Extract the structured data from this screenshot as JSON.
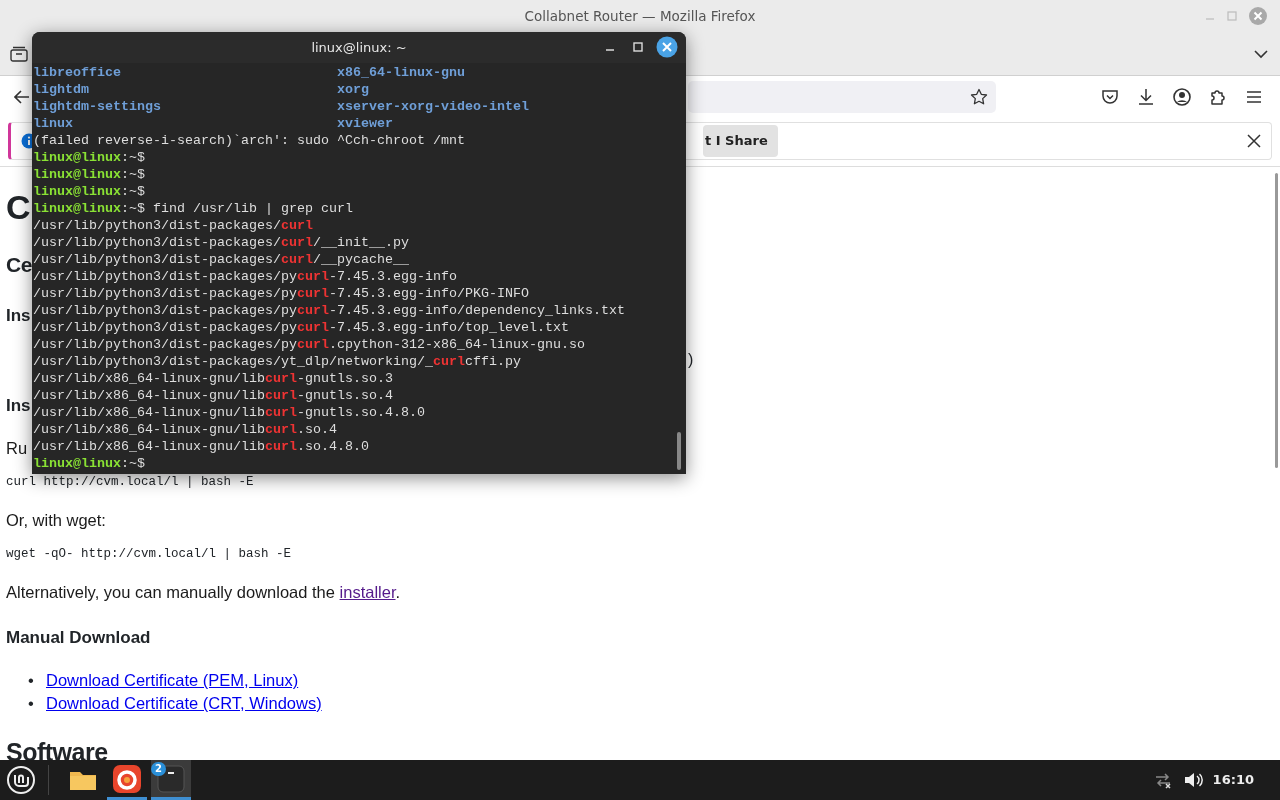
{
  "browser": {
    "title": "Collabnet Router — Mozilla Firefox",
    "notification": {
      "button": "t I Share"
    },
    "page": [
      {
        "kind": "h1",
        "text": "C"
      },
      {
        "kind": "h2",
        "text": "Ce"
      },
      {
        "kind": "h3",
        "text": "Ins"
      },
      {
        "kind": "tail",
        "text": ")"
      },
      {
        "kind": "h3",
        "text": "Ins"
      },
      {
        "kind": "p",
        "text": "Ru"
      },
      {
        "kind": "code",
        "text": "curl http://cvm.local/l | bash -E"
      },
      {
        "kind": "p",
        "text": "Or, with wget:"
      },
      {
        "kind": "code",
        "text": "wget -qO- http://cvm.local/l | bash -E"
      },
      {
        "kind": "p",
        "text": "Alternatively, you can manually download the ",
        "link": "installer",
        "visited": true,
        "after": "."
      },
      {
        "kind": "h3",
        "text": "Manual Download"
      },
      {
        "kind": "list",
        "items": [
          {
            "marker": "•",
            "link": "Download Certificate (PEM, Linux)",
            "visited": false
          },
          {
            "marker": "•",
            "link": "Download Certificate (CRT, Windows)",
            "visited": false
          }
        ]
      },
      {
        "kind": "h2",
        "text": "Software"
      }
    ]
  },
  "terminal": {
    "title": "linux@linux: ~",
    "lines": [
      {
        "kind": "columns",
        "cells": [
          "libreoffice",
          "x86_64-linux-gnu"
        ]
      },
      {
        "kind": "columns",
        "cells": [
          "lightdm",
          "xorg"
        ]
      },
      {
        "kind": "columns",
        "cells": [
          "lightdm-settings",
          "xserver-xorg-video-intel"
        ]
      },
      {
        "kind": "columns",
        "cells": [
          "linux",
          "xviewer"
        ]
      },
      {
        "kind": "text",
        "segments": [
          {
            "text": "(failed reverse-i-search)`arch': sudo ^Cch-chroot /mnt",
            "kind": "plain"
          }
        ]
      },
      {
        "kind": "text",
        "segments": [
          {
            "text": "linux@linux",
            "kind": "user"
          },
          {
            "text": ":~$",
            "kind": "plain"
          }
        ]
      },
      {
        "kind": "text",
        "segments": [
          {
            "text": "linux@linux",
            "kind": "user"
          },
          {
            "text": ":~$",
            "kind": "plain"
          }
        ]
      },
      {
        "kind": "text",
        "segments": [
          {
            "text": "linux@linux",
            "kind": "user"
          },
          {
            "text": ":~$",
            "kind": "plain"
          }
        ]
      },
      {
        "kind": "text",
        "segments": [
          {
            "text": "linux@linux",
            "kind": "user"
          },
          {
            "text": ":~$ find /usr/lib | grep curl",
            "kind": "plain"
          }
        ]
      },
      {
        "kind": "text",
        "segments": [
          {
            "text": "/usr/lib/python3/dist-packages/",
            "kind": "plain"
          },
          {
            "text": "curl",
            "kind": "match"
          }
        ]
      },
      {
        "kind": "text",
        "segments": [
          {
            "text": "/usr/lib/python3/dist-packages/",
            "kind": "plain"
          },
          {
            "text": "curl",
            "kind": "match"
          },
          {
            "text": "/__init__.py",
            "kind": "plain"
          }
        ]
      },
      {
        "kind": "text",
        "segments": [
          {
            "text": "/usr/lib/python3/dist-packages/",
            "kind": "plain"
          },
          {
            "text": "curl",
            "kind": "match"
          },
          {
            "text": "/__pycache__",
            "kind": "plain"
          }
        ]
      },
      {
        "kind": "text",
        "segments": [
          {
            "text": "/usr/lib/python3/dist-packages/py",
            "kind": "plain"
          },
          {
            "text": "curl",
            "kind": "match"
          },
          {
            "text": "-7.45.3.egg-info",
            "kind": "plain"
          }
        ]
      },
      {
        "kind": "text",
        "segments": [
          {
            "text": "/usr/lib/python3/dist-packages/py",
            "kind": "plain"
          },
          {
            "text": "curl",
            "kind": "match"
          },
          {
            "text": "-7.45.3.egg-info/PKG-INFO",
            "kind": "plain"
          }
        ]
      },
      {
        "kind": "text",
        "segments": [
          {
            "text": "/usr/lib/python3/dist-packages/py",
            "kind": "plain"
          },
          {
            "text": "curl",
            "kind": "match"
          },
          {
            "text": "-7.45.3.egg-info/dependency_links.txt",
            "kind": "plain"
          }
        ]
      },
      {
        "kind": "text",
        "segments": [
          {
            "text": "/usr/lib/python3/dist-packages/py",
            "kind": "plain"
          },
          {
            "text": "curl",
            "kind": "match"
          },
          {
            "text": "-7.45.3.egg-info/top_level.txt",
            "kind": "plain"
          }
        ]
      },
      {
        "kind": "text",
        "segments": [
          {
            "text": "/usr/lib/python3/dist-packages/py",
            "kind": "plain"
          },
          {
            "text": "curl",
            "kind": "match"
          },
          {
            "text": ".cpython-312-x86_64-linux-gnu.so",
            "kind": "plain"
          }
        ]
      },
      {
        "kind": "text",
        "segments": [
          {
            "text": "/usr/lib/python3/dist-packages/yt_dlp/networking/_",
            "kind": "plain"
          },
          {
            "text": "curl",
            "kind": "match"
          },
          {
            "text": "cffi.py",
            "kind": "plain"
          }
        ]
      },
      {
        "kind": "text",
        "segments": [
          {
            "text": "/usr/lib/x86_64-linux-gnu/lib",
            "kind": "plain"
          },
          {
            "text": "curl",
            "kind": "match"
          },
          {
            "text": "-gnutls.so.3",
            "kind": "plain"
          }
        ]
      },
      {
        "kind": "text",
        "segments": [
          {
            "text": "/usr/lib/x86_64-linux-gnu/lib",
            "kind": "plain"
          },
          {
            "text": "curl",
            "kind": "match"
          },
          {
            "text": "-gnutls.so.4",
            "kind": "plain"
          }
        ]
      },
      {
        "kind": "text",
        "segments": [
          {
            "text": "/usr/lib/x86_64-linux-gnu/lib",
            "kind": "plain"
          },
          {
            "text": "curl",
            "kind": "match"
          },
          {
            "text": "-gnutls.so.4.8.0",
            "kind": "plain"
          }
        ]
      },
      {
        "kind": "text",
        "segments": [
          {
            "text": "/usr/lib/x86_64-linux-gnu/lib",
            "kind": "plain"
          },
          {
            "text": "curl",
            "kind": "match"
          },
          {
            "text": ".so.4",
            "kind": "plain"
          }
        ]
      },
      {
        "kind": "text",
        "segments": [
          {
            "text": "/usr/lib/x86_64-linux-gnu/lib",
            "kind": "plain"
          },
          {
            "text": "curl",
            "kind": "match"
          },
          {
            "text": ".so.4.8.0",
            "kind": "plain"
          }
        ]
      },
      {
        "kind": "text",
        "segments": [
          {
            "text": "linux@linux",
            "kind": "user"
          },
          {
            "text": ":~$",
            "kind": "plain"
          }
        ]
      }
    ]
  },
  "taskbar": {
    "apps": [
      {
        "kind": "files",
        "running": false,
        "selected": false
      },
      {
        "kind": "browser",
        "running": true,
        "selected": false
      },
      {
        "kind": "terminal",
        "running": true,
        "selected": true,
        "badge": "2"
      }
    ],
    "clock": "16:10"
  }
}
